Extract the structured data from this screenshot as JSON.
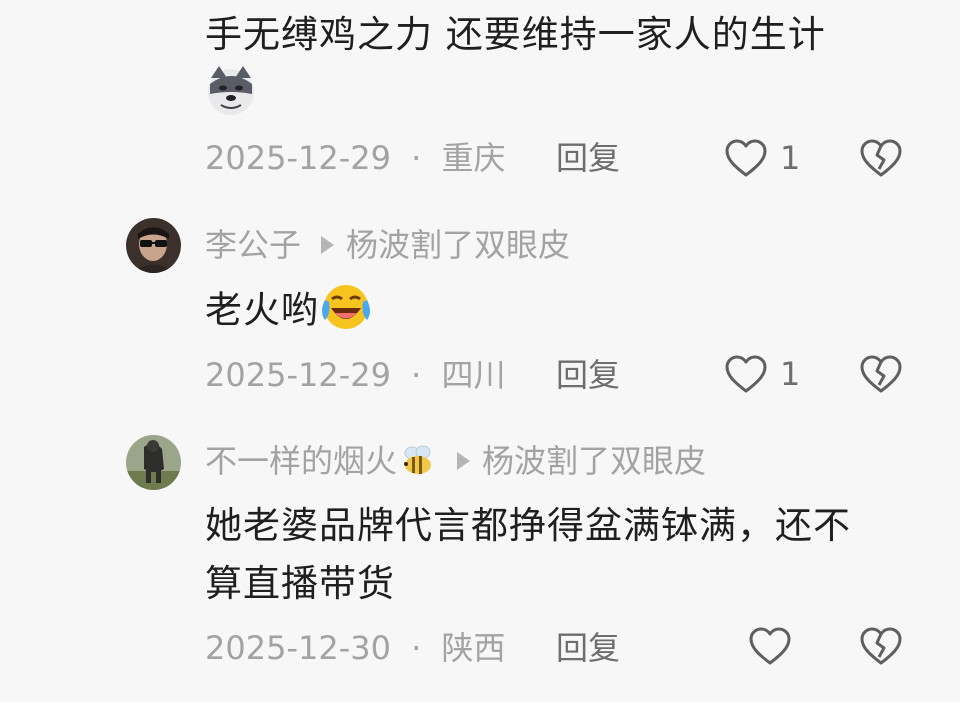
{
  "comments": [
    {
      "text_lines": [
        "手无缚鸡之力 还要维持一家人的生计"
      ],
      "sticker": "doge-face-sticker",
      "date": "2025-12-29",
      "separator": "·",
      "location": "重庆",
      "reply_label": "回复",
      "like_count": "1"
    },
    {
      "username": "李公子",
      "reply_to": "杨波割了双眼皮",
      "text_lines": [
        "老火哟"
      ],
      "emoji": "crying-laughing-emoji",
      "date": "2025-12-29",
      "separator": "·",
      "location": "四川",
      "reply_label": "回复",
      "like_count": "1"
    },
    {
      "username": "不一样的烟火",
      "username_emoji": "bee-icon",
      "reply_to": "杨波割了双眼皮",
      "text_lines": [
        "她老婆品牌代言都挣得盆满钵满，还不",
        "算直播带货"
      ],
      "date": "2025-12-30",
      "separator": "·",
      "location": "陕西",
      "reply_label": "回复",
      "like_count": ""
    }
  ],
  "colors": {
    "background": "#f7f7f7",
    "text": "#1f1f1f",
    "meta": "#a3a3a3",
    "action": "#6e6e6e"
  }
}
